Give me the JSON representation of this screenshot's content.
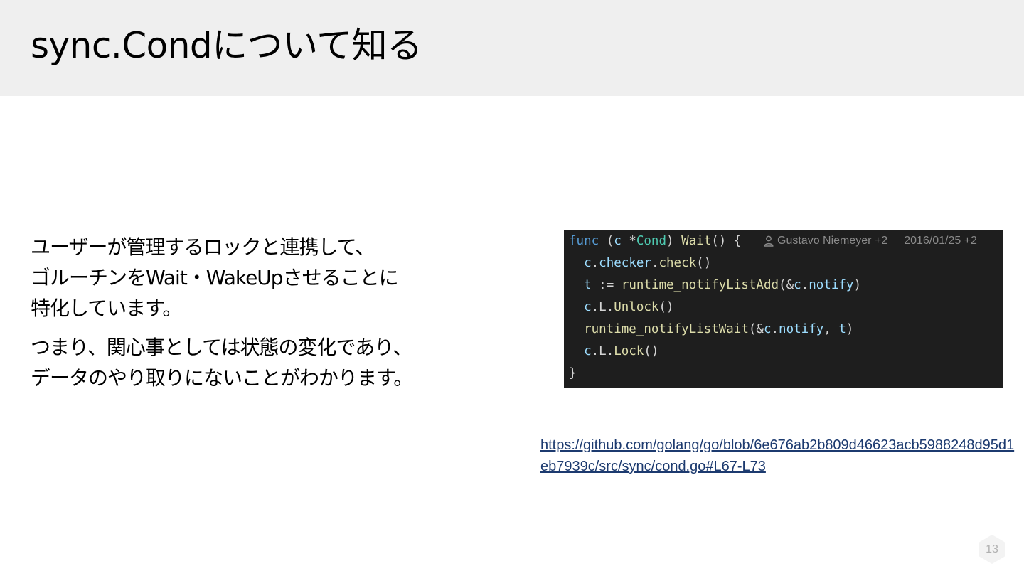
{
  "slide": {
    "title": "sync.Condについて知る",
    "paragraphs": [
      [
        "ユーザーが管理するロックと連携して、",
        "ゴルーチンをWait・WakeUpさせることに",
        "特化しています。"
      ],
      [
        "つまり、関心事としては状態の変化であり、",
        "データのやり取りにないことがわかります。"
      ]
    ],
    "code": {
      "blame_author": "Gustavo Niemeyer +2",
      "blame_date": "2016/01/25 +2",
      "lines": [
        "func (c *Cond) Wait() {",
        "  c.checker.check()",
        "  t := runtime_notifyListAdd(&c.notify)",
        "  c.L.Unlock()",
        "  runtime_notifyListWait(&c.notify, t)",
        "  c.L.Lock()",
        "}"
      ]
    },
    "link": "https://github.com/golang/go/blob/6e676ab2b809d46623acb5988248d95d1eb7939c/src/sync/cond.go#L67-L73",
    "page_number": "13"
  }
}
